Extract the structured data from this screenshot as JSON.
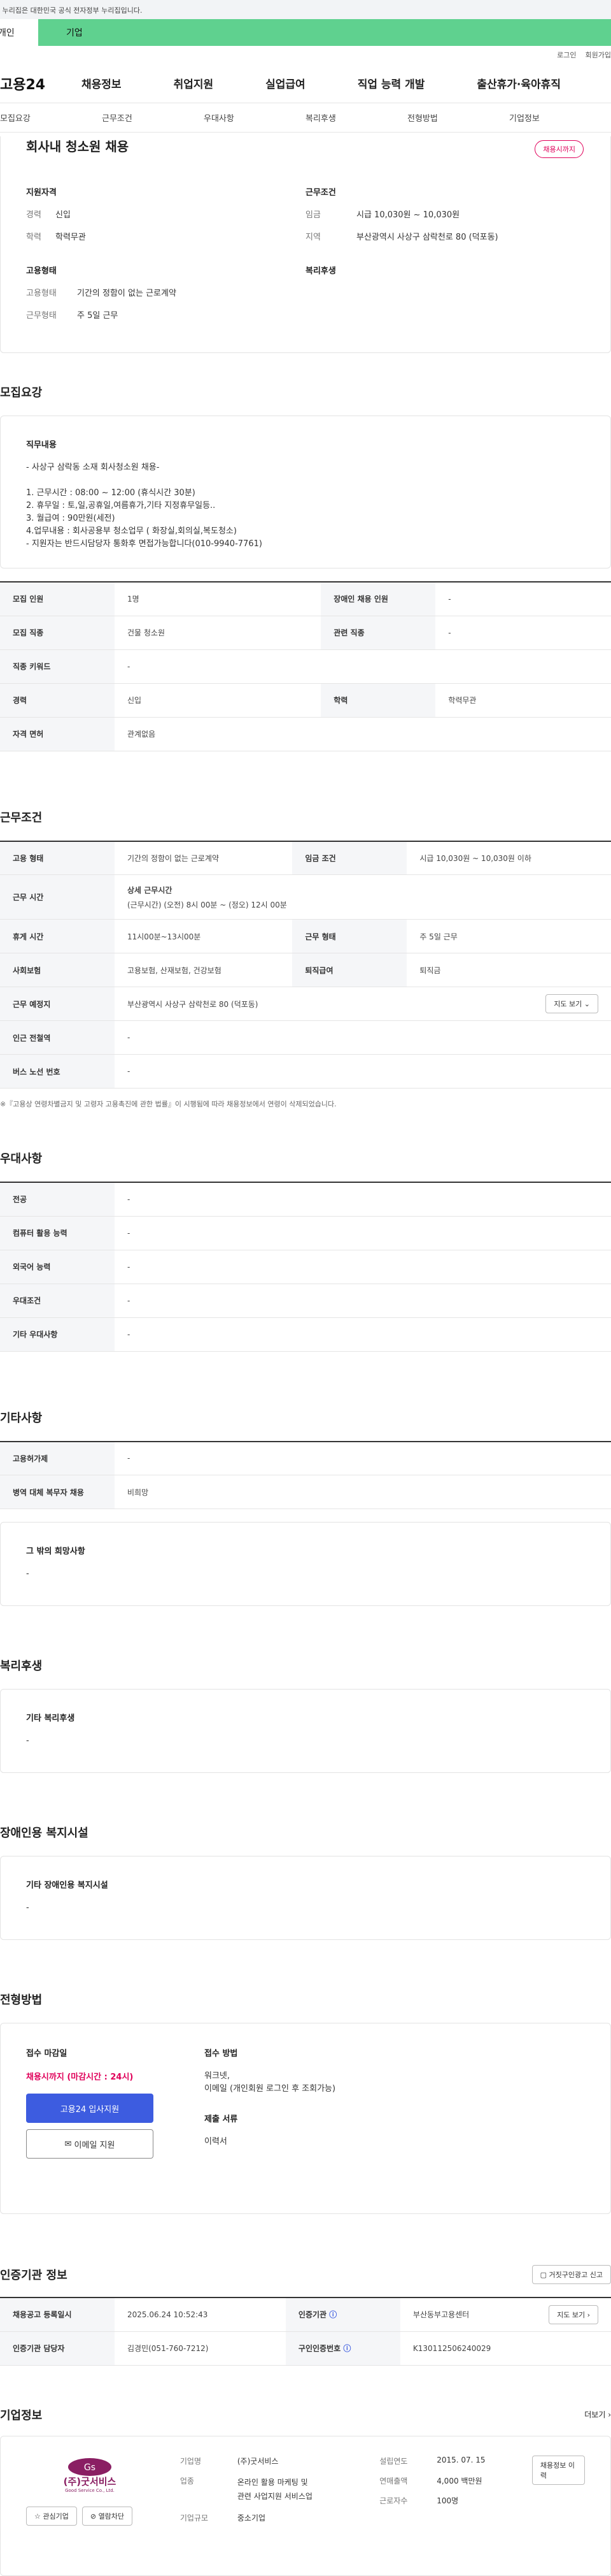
{
  "gov_notice": "이 누리집은 대한민국 공식 전자정부 누리집입니다.",
  "toggle": {
    "individual": "개인",
    "company": "기업"
  },
  "utility": {
    "login": "로그인",
    "signup": "회원가입"
  },
  "logo": "고용24",
  "gnb": [
    "채용정보",
    "취업지원",
    "실업급여",
    "직업 능력 개발",
    "출산휴가·육아휴직"
  ],
  "tabs": [
    "모집요강",
    "근무조건",
    "우대사항",
    "복리후생",
    "전형방법",
    "기업정보"
  ],
  "job": {
    "title": "회사내 청소원 채용",
    "badge": "채용시까지",
    "qual_title": "지원자격",
    "career_k": "경력",
    "career_v": "신입",
    "edu_k": "학력",
    "edu_v": "학력무관",
    "cond_title": "근무조건",
    "wage_k": "임금",
    "wage_v": "시급 10,030원 ~ 10,030원",
    "region_k": "지역",
    "region_v": "부산광역시 사상구 삼락천로 80 (덕포동)",
    "emp_title": "고용형태",
    "emp_k": "고용형태",
    "emp_v": "기간의 정함이 없는 근로계약",
    "hours_k": "근무형태",
    "hours_v": "주 5일 근무",
    "welfare_title": "복리후생"
  },
  "recruit": {
    "title": "모집요강",
    "duty_title": "직무내용",
    "duty_text": "- 사상구 삼락동 소재 회사청소원 채용-\n\n1. 근무시간 : 08:00 ~ 12:00 (휴식시간 30분)\n2. 휴무일 : 토,일,공휴일,여름휴가,기타 지정휴무일등..\n3. 월급여 : 90만원(세전)\n4.업무내용 : 회사공용부 청소업무 ( 화장실,회의실,복도청소)\n  - 지원자는 반드시담당자 통화후 면접가능합니다(010-9940-7761)",
    "rows": [
      [
        "모집 인원",
        "1명",
        "장애인 채용 인원",
        "-"
      ],
      [
        "모집 직종",
        "건물 청소원",
        "관련 직종",
        "-"
      ],
      [
        "직종 키워드",
        "-"
      ],
      [
        "경력",
        "신입",
        "학력",
        "학력무관"
      ],
      [
        "자격 면허",
        "관계없음"
      ]
    ]
  },
  "conditions": {
    "title": "근무조건",
    "emp_k": "고용 형태",
    "emp_v": "기간의 정함이 없는 근로계약",
    "wage_k": "임금 조건",
    "wage_v": "시급 10,030원 ~ 10,030원 이하",
    "time_k": "근무 시간",
    "time_title": "상세 근무시간",
    "time_v": "(근무시간) (오전) 8시 00분 ~ (정오) 12시 00분",
    "break_k": "휴게 시간",
    "break_v": "11시00분~13시00분",
    "form_k": "근무 형태",
    "form_v": "주 5일 근무",
    "ins_k": "사회보험",
    "ins_v": "고용보험, 산재보험, 건강보험",
    "ret_k": "퇴직급여",
    "ret_v": "퇴직금",
    "place_k": "근무 예정지",
    "place_v": "부산광역시 사상구 삼락천로 80 (덕포동)",
    "map_btn": "지도 보기",
    "sub_k": "인근 전철역",
    "sub_v": "-",
    "bus_k": "버스 노선 번호",
    "bus_v": "-",
    "note": "※『고용상 연령차별금지 및 고령자 고용촉진에 관한 법률』이 시행됨에 따라 채용정보에서 연령이 삭제되었습니다."
  },
  "pref": {
    "title": "우대사항",
    "rows": [
      [
        "전공",
        "-"
      ],
      [
        "컴퓨터 활용 능력",
        "-"
      ],
      [
        "외국어 능력",
        "-"
      ],
      [
        "우대조건",
        "-"
      ],
      [
        "기타 우대사항",
        "-"
      ]
    ]
  },
  "etc": {
    "title": "기타사항",
    "rows": [
      [
        "고용허가제",
        "-"
      ],
      [
        "병역 대체 복무자 채용",
        "비희망"
      ]
    ],
    "other_title": "그 밖의 희망사항",
    "other_v": "-"
  },
  "welfare": {
    "title": "복리후생",
    "box_title": "기타 복리후생",
    "box_v": "-"
  },
  "disabled": {
    "title": "장애인용 복지시설",
    "box_title": "기타 장애인용 복지시설",
    "box_v": "-"
  },
  "process": {
    "title": "전형방법",
    "deadline_title": "접수 마감일",
    "deadline_v": "채용시까지 (마감시간 : 24시)",
    "apply_btn": "고용24 입사지원",
    "email_btn": "이메일 지원",
    "method_title": "접수 방법",
    "method_v": "워크넷,\n이메일 (개인회원 로그인 후 조회가능)",
    "docs_title": "제출 서류",
    "docs_v": "이력서"
  },
  "cert": {
    "title": "인증기관 정보",
    "report_btn": "거짓구인광고 신고",
    "reg_k": "채용공고 등록일시",
    "reg_v": "2025.06.24 10:52:43",
    "org_k": "인증기관",
    "org_v": "부산동부고용센터",
    "map_btn": "지도 보기",
    "mgr_k": "인증기관 담당자",
    "mgr_v": "김경민(051-760-7212)",
    "num_k": "구인인증번호",
    "num_v": "K130112506240029"
  },
  "company": {
    "title": "기업정보",
    "more": "더보기",
    "logo_text": "(주)굿서비스",
    "logo_en": "Good Service Co., Ltd.",
    "fav_btn": "관심기업",
    "block_btn": "열람차단",
    "name_k": "기업명",
    "name_v": "(주)굿서비스",
    "ind_k": "업종",
    "ind_v": "온라인 활용 마케팅 및 관련 사업지원 서비스업",
    "size_k": "기업규모",
    "size_v": "중소기업",
    "est_k": "설립연도",
    "est_v": "2015. 07. 15",
    "sales_k": "연매출액",
    "sales_v": "4,000 백만원",
    "emp_k": "근로자수",
    "emp_v": "100명",
    "history_btn": "채용정보 이력"
  },
  "colors": {
    "accent": "#3d5ce0",
    "highlight": "#e0005a",
    "green": "#5fd18f"
  }
}
